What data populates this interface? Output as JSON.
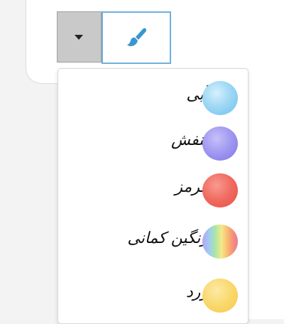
{
  "colors": {
    "page_background": "#f3f3f3",
    "toggle_background": "#c9c9c9",
    "brush_button_border": "#6fb0dc",
    "brush_icon": "#3a96cf"
  },
  "toolbar": {
    "dropdown_toggle_icon": "caret-down-icon",
    "brush_button_icon": "paintbrush-icon"
  },
  "color_menu": {
    "items": [
      {
        "label": "آبی",
        "swatch": "blue-watercolor-swatch",
        "color": "#8ecdf0"
      },
      {
        "label": "بنفش",
        "swatch": "purple-watercolor-swatch",
        "color": "#9d95ee"
      },
      {
        "label": "قرمز",
        "swatch": "red-watercolor-swatch",
        "color": "#f2675e"
      },
      {
        "label": "رنگین کمانی",
        "swatch": "rainbow-watercolor-swatch",
        "color": "rainbow"
      },
      {
        "label": "زرد",
        "swatch": "yellow-watercolor-swatch",
        "color": "#f8d66a"
      }
    ]
  }
}
